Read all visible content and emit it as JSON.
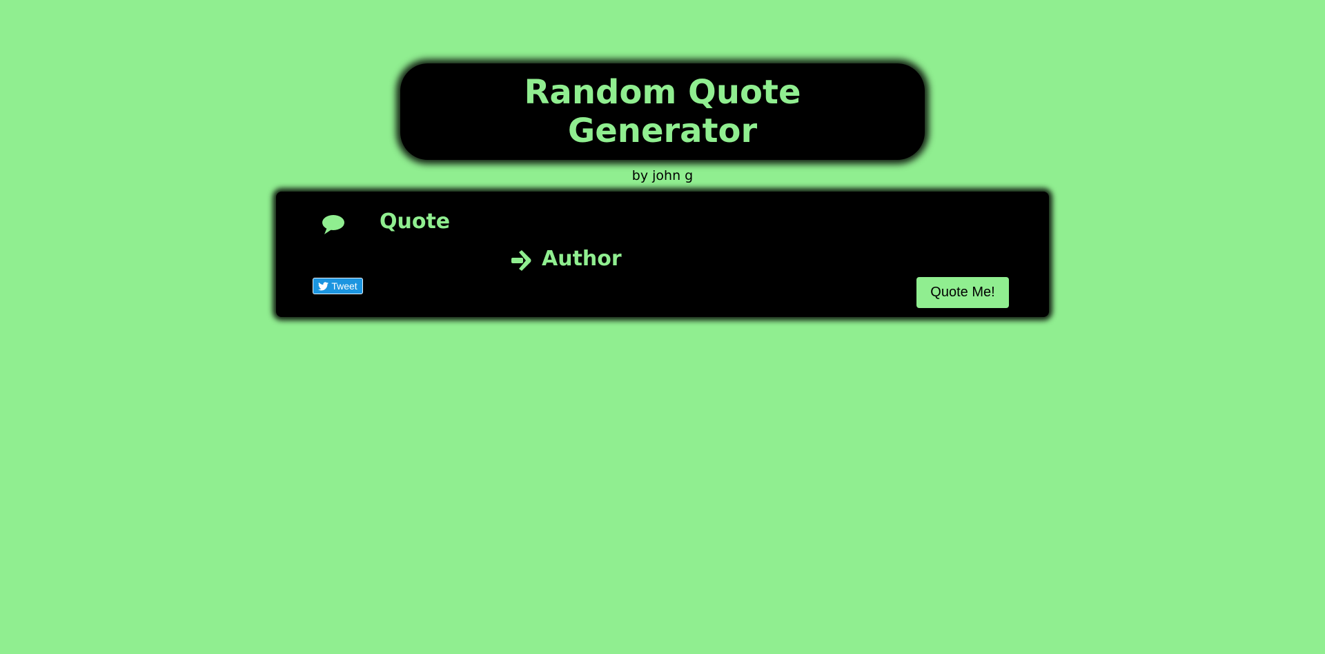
{
  "header": {
    "title": "Random Quote Generator",
    "byline": "by john g"
  },
  "quote": {
    "icon": "speech-bubble-icon",
    "text": "Quote",
    "author_icon": "arrow-right-icon",
    "author": "Author"
  },
  "actions": {
    "tweet_label": "Tweet",
    "tweet_icon": "twitter-bird-icon",
    "quote_me_label": "Quote Me!"
  },
  "colors": {
    "background": "#90ee90",
    "panel": "#000000",
    "accent": "#90ee90",
    "tweet_button": "#1b95e0"
  }
}
